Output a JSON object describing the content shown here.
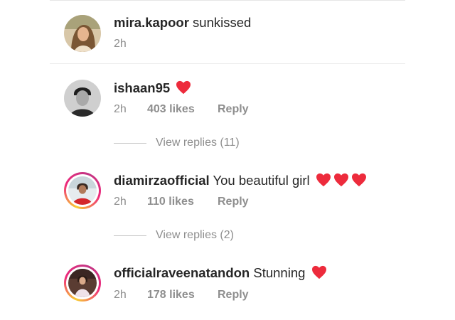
{
  "comments": [
    {
      "username": "mira.kapoor",
      "text": "sunkissed",
      "hearts": 0,
      "time": "2h",
      "story_ring": false,
      "avatar": "woman-portrait"
    },
    {
      "username": "ishaan95",
      "text": "",
      "hearts": 1,
      "time": "2h",
      "likes": "403 likes",
      "reply": "Reply",
      "view_replies": "View replies (11)",
      "story_ring": false,
      "avatar": "man-portrait-bw"
    },
    {
      "username": "diamirzaofficial",
      "text": "You beautiful girl",
      "hearts": 3,
      "time": "2h",
      "likes": "110 likes",
      "reply": "Reply",
      "view_replies": "View replies (2)",
      "story_ring": true,
      "avatar": "woman-red-jacket"
    },
    {
      "username": "officialraveenatandon",
      "text": "Stunning",
      "hearts": 1,
      "time": "2h",
      "likes": "178 likes",
      "reply": "Reply",
      "story_ring": true,
      "avatar": "woman-light-dress"
    }
  ],
  "colors": {
    "heart": "#ed2b3c",
    "meta_gray": "#8e8e8e",
    "text": "#262626",
    "story_ring": [
      "#f9ce34",
      "#ee2a7b",
      "#c13584"
    ]
  },
  "icons": {
    "heart": "red-heart-emoji"
  }
}
